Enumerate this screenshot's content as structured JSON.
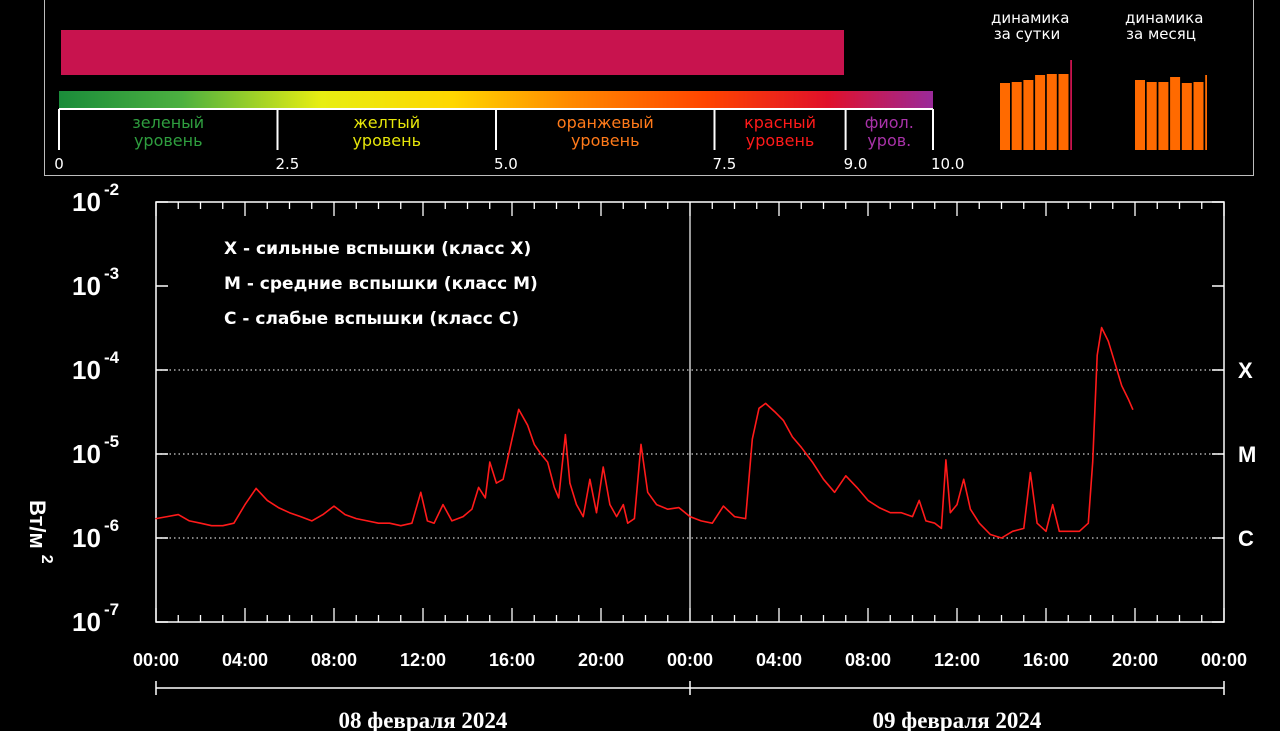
{
  "index_bar": {
    "value": 9.0,
    "max": 10.0,
    "bar_color": "#c8134e",
    "scale_ticks": [
      "0",
      "2.5",
      "5.0",
      "7.5",
      "9.0",
      "10.0"
    ],
    "levels": [
      {
        "line1": "зеленый",
        "line2": "уровень",
        "color": "#2f9e3f"
      },
      {
        "line1": "желтый",
        "line2": "уровень",
        "color": "#e6e60a"
      },
      {
        "line1": "оранжевый",
        "line2": "уровень",
        "color": "#ff7a1a"
      },
      {
        "line1": "красный",
        "line2": "уровень",
        "color": "#ff1a1a"
      },
      {
        "line1": "фиол.",
        "line2": "уров.",
        "color": "#a832a8"
      }
    ]
  },
  "dynamics": {
    "daily": {
      "title_line1": "динамика",
      "title_line2": "за сутки",
      "values": [
        6.7,
        6.8,
        7.0,
        7.5,
        7.6,
        7.6,
        9.0
      ],
      "colors": [
        "#ff6a00",
        "#ff6a00",
        "#ff6a00",
        "#ff6a00",
        "#ff6a00",
        "#ff6a00",
        "#c8134e"
      ]
    },
    "monthly": {
      "title_line1": "динамика",
      "title_line2": "за месяц",
      "values": [
        7.0,
        6.8,
        6.8,
        7.3,
        6.7,
        6.8,
        7.5
      ],
      "colors": [
        "#ff6a00",
        "#ff6a00",
        "#ff6a00",
        "#ff6a00",
        "#ff6a00",
        "#ff6a00",
        "#ff6a00"
      ]
    }
  },
  "chart_data": {
    "type": "line",
    "y_scale": "log",
    "ylim": [
      1e-07,
      0.01
    ],
    "y_ticks": [
      {
        "base": "10",
        "exp": "-2",
        "value": 0.01
      },
      {
        "base": "10",
        "exp": "-3",
        "value": 0.001
      },
      {
        "base": "10",
        "exp": "-4",
        "value": 0.0001
      },
      {
        "base": "10",
        "exp": "-5",
        "value": 1e-05
      },
      {
        "base": "10",
        "exp": "-6",
        "value": 1e-06
      },
      {
        "base": "10",
        "exp": "-7",
        "value": 1e-07
      }
    ],
    "ylabel": "Вт/м",
    "ylabel_exp": "2",
    "x_range_hours": [
      0,
      48
    ],
    "x_tick_labels": [
      "00:00",
      "04:00",
      "08:00",
      "12:00",
      "16:00",
      "20:00",
      "00:00",
      "04:00",
      "08:00",
      "12:00",
      "16:00",
      "20:00",
      "00:00"
    ],
    "dates": [
      "08 февраля 2024",
      "09 февраля 2024"
    ],
    "class_levels": [
      {
        "label": "X",
        "value": 0.0001
      },
      {
        "label": "M",
        "value": 1e-05
      },
      {
        "label": "C",
        "value": 1e-06
      }
    ],
    "legend": [
      "X  - сильные вспышки (класс X)",
      "M - средние вспышки (класс M)",
      "C  - слабые вспышки (класс C)"
    ],
    "line_color": "#ff1a1a",
    "series": [
      {
        "points": [
          [
            0.0,
            1.7e-06
          ],
          [
            0.5,
            1.8e-06
          ],
          [
            1.0,
            1.9e-06
          ],
          [
            1.5,
            1.6e-06
          ],
          [
            2.0,
            1.5e-06
          ],
          [
            2.5,
            1.4e-06
          ],
          [
            3.0,
            1.4e-06
          ],
          [
            3.5,
            1.5e-06
          ],
          [
            4.0,
            2.5e-06
          ],
          [
            4.5,
            3.9e-06
          ],
          [
            5.0,
            2.8e-06
          ],
          [
            5.5,
            2.3e-06
          ],
          [
            6.0,
            2e-06
          ],
          [
            6.5,
            1.8e-06
          ],
          [
            7.0,
            1.6e-06
          ],
          [
            7.5,
            1.9e-06
          ],
          [
            8.0,
            2.4e-06
          ],
          [
            8.5,
            1.9e-06
          ],
          [
            9.0,
            1.7e-06
          ],
          [
            9.5,
            1.6e-06
          ],
          [
            10.0,
            1.5e-06
          ],
          [
            10.5,
            1.5e-06
          ],
          [
            11.0,
            1.4e-06
          ],
          [
            11.5,
            1.5e-06
          ],
          [
            11.9,
            3.5e-06
          ],
          [
            12.2,
            1.6e-06
          ],
          [
            12.5,
            1.5e-06
          ],
          [
            12.9,
            2.5e-06
          ],
          [
            13.3,
            1.6e-06
          ],
          [
            13.8,
            1.8e-06
          ],
          [
            14.2,
            2.2e-06
          ],
          [
            14.5,
            4e-06
          ],
          [
            14.8,
            3e-06
          ],
          [
            15.0,
            8e-06
          ],
          [
            15.3,
            4.5e-06
          ],
          [
            15.6,
            5e-06
          ],
          [
            16.0,
            1.5e-05
          ],
          [
            16.3,
            3.4e-05
          ],
          [
            16.7,
            2.2e-05
          ],
          [
            17.0,
            1.3e-05
          ],
          [
            17.3,
            1e-05
          ],
          [
            17.6,
            8e-06
          ],
          [
            17.9,
            4e-06
          ],
          [
            18.1,
            3e-06
          ],
          [
            18.4,
            1.7e-05
          ],
          [
            18.6,
            4.5e-06
          ],
          [
            18.9,
            2.5e-06
          ],
          [
            19.2,
            1.8e-06
          ],
          [
            19.5,
            5e-06
          ],
          [
            19.8,
            2e-06
          ],
          [
            20.1,
            7e-06
          ],
          [
            20.4,
            2.5e-06
          ],
          [
            20.7,
            1.8e-06
          ],
          [
            21.0,
            2.5e-06
          ],
          [
            21.2,
            1.5e-06
          ],
          [
            21.5,
            1.7e-06
          ],
          [
            21.8,
            1.3e-05
          ],
          [
            22.1,
            3.5e-06
          ],
          [
            22.5,
            2.5e-06
          ],
          [
            23.0,
            2.2e-06
          ],
          [
            23.5,
            2.3e-06
          ],
          [
            24.0,
            1.8e-06
          ],
          [
            24.5,
            1.6e-06
          ],
          [
            25.0,
            1.5e-06
          ],
          [
            25.5,
            2.4e-06
          ],
          [
            26.0,
            1.8e-06
          ],
          [
            26.5,
            1.7e-06
          ],
          [
            26.8,
            1.5e-05
          ],
          [
            27.1,
            3.5e-05
          ],
          [
            27.4,
            4e-05
          ],
          [
            27.8,
            3.2e-05
          ],
          [
            28.2,
            2.5e-05
          ],
          [
            28.6,
            1.6e-05
          ],
          [
            29.0,
            1.2e-05
          ],
          [
            29.5,
            8e-06
          ],
          [
            30.0,
            5e-06
          ],
          [
            30.5,
            3.5e-06
          ],
          [
            31.0,
            5.5e-06
          ],
          [
            31.5,
            4e-06
          ],
          [
            32.0,
            2.8e-06
          ],
          [
            32.5,
            2.3e-06
          ],
          [
            33.0,
            2e-06
          ],
          [
            33.5,
            2e-06
          ],
          [
            34.0,
            1.8e-06
          ],
          [
            34.3,
            2.8e-06
          ],
          [
            34.6,
            1.6e-06
          ],
          [
            35.0,
            1.5e-06
          ],
          [
            35.3,
            1.3e-06
          ],
          [
            35.5,
            8.5e-06
          ],
          [
            35.7,
            2e-06
          ],
          [
            36.0,
            2.5e-06
          ],
          [
            36.3,
            5e-06
          ],
          [
            36.6,
            2.2e-06
          ],
          [
            37.0,
            1.5e-06
          ],
          [
            37.5,
            1.1e-06
          ],
          [
            38.0,
            1e-06
          ],
          [
            38.5,
            1.2e-06
          ],
          [
            39.0,
            1.3e-06
          ],
          [
            39.3,
            6e-06
          ],
          [
            39.6,
            1.5e-06
          ],
          [
            40.0,
            1.2e-06
          ],
          [
            40.3,
            2.5e-06
          ],
          [
            40.6,
            1.2e-06
          ],
          [
            41.0,
            1.2e-06
          ],
          [
            41.5,
            1.2e-06
          ],
          [
            41.9,
            1.5e-06
          ],
          [
            42.1,
            8e-06
          ],
          [
            42.3,
            0.00015
          ],
          [
            42.5,
            0.00032
          ],
          [
            42.8,
            0.00022
          ],
          [
            43.1,
            0.00012
          ],
          [
            43.4,
            6.5e-05
          ],
          [
            43.7,
            4.5e-05
          ],
          [
            43.9,
            3.4e-05
          ]
        ]
      }
    ]
  }
}
